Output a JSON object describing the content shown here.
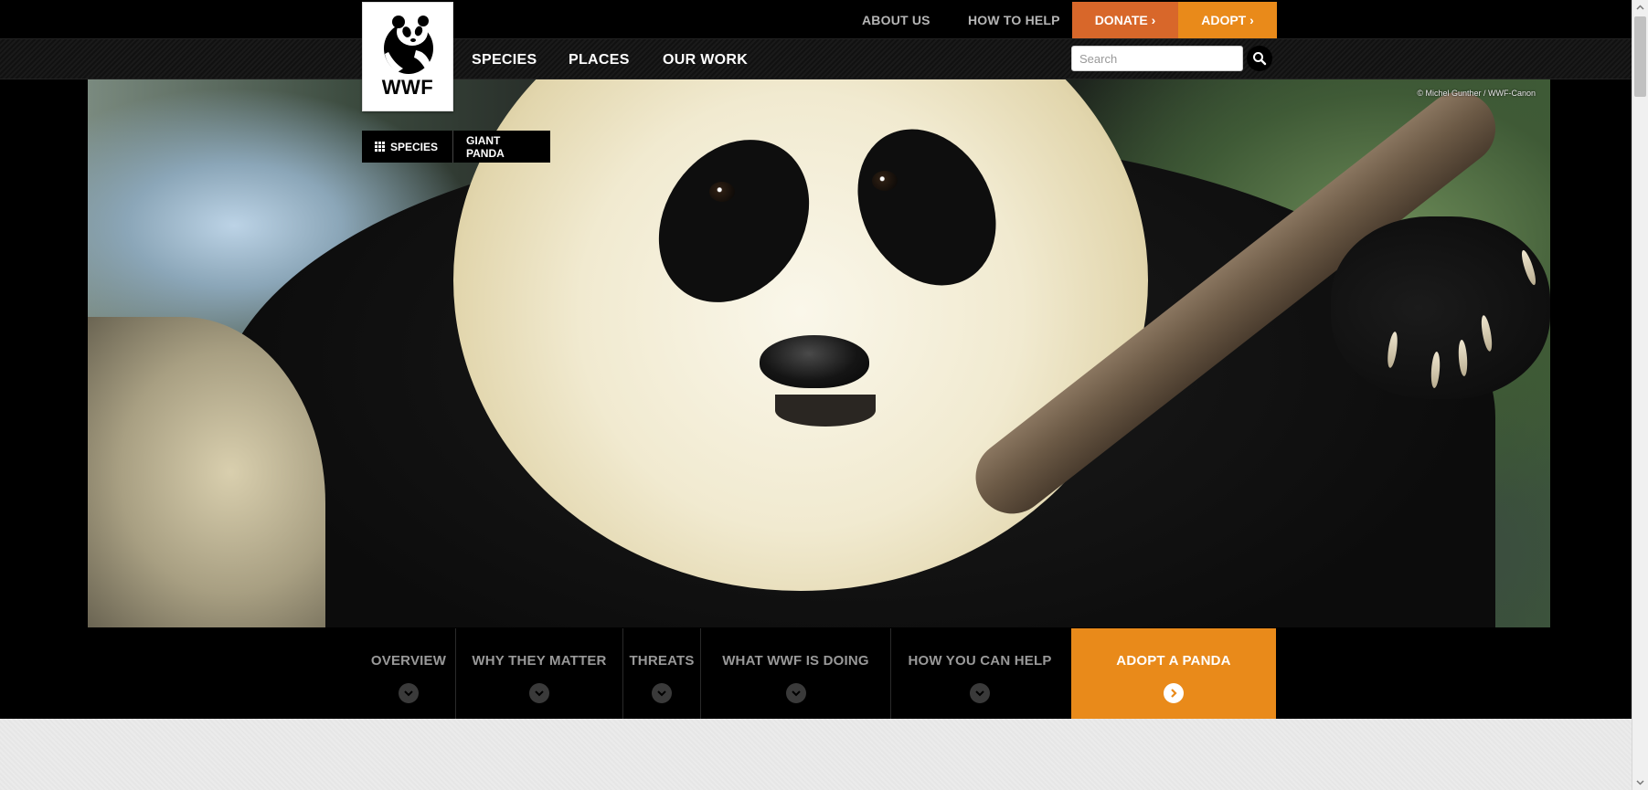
{
  "utility_nav": {
    "about": "ABOUT US",
    "how_to_help": "HOW TO HELP",
    "donate": "DONATE ›",
    "adopt": "ADOPT ›"
  },
  "main_nav": {
    "species": "SPECIES",
    "places": "PLACES",
    "our_work": "OUR WORK"
  },
  "logo": {
    "text": "WWF",
    "icon": "panda-logo-icon"
  },
  "search": {
    "placeholder": "Search",
    "icon": "search-icon"
  },
  "hero": {
    "photo_credit": "© Michel Gunther / WWF-Canon"
  },
  "breadcrumb": {
    "section": "SPECIES",
    "current": "GIANT PANDA",
    "icon": "grid-icon"
  },
  "section_tabs": [
    {
      "label": "OVERVIEW",
      "icon": "chevron-down-icon"
    },
    {
      "label": "WHY THEY MATTER",
      "icon": "chevron-down-icon"
    },
    {
      "label": "THREATS",
      "icon": "chevron-down-icon"
    },
    {
      "label": "WHAT WWF IS DOING",
      "icon": "chevron-down-icon"
    },
    {
      "label": "HOW YOU CAN HELP",
      "icon": "chevron-down-icon"
    },
    {
      "label": "ADOPT A PANDA",
      "icon": "chevron-right-icon"
    }
  ],
  "colors": {
    "donate": "#d8672a",
    "adopt": "#e98a1a",
    "background": "#000000",
    "tab_text": "#999999"
  }
}
